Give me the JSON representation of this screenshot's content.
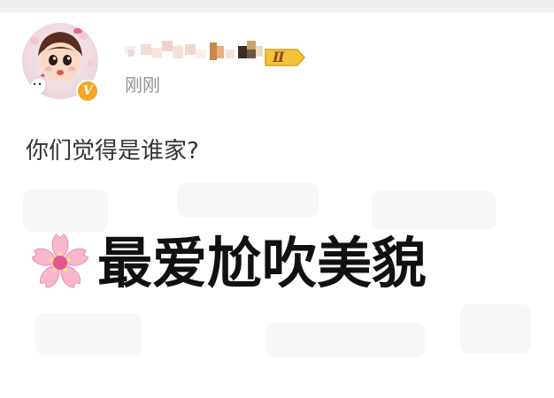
{
  "post": {
    "timestamp": "刚刚",
    "text": "你们觉得是谁家?",
    "image_caption": "最爱尬吹美貌",
    "image_emoji_icon": "cherry-blossom-icon"
  },
  "user": {
    "avatar_icon": "cartoon-girl-avatar",
    "verified_icon": "verified-v-icon",
    "verified_letter": "V",
    "level_badge_icon": "level-badge-icon",
    "level_badge_text": "Ⅱ"
  },
  "colors": {
    "verified": "#f5a623",
    "level_badge": "#f3c33c",
    "timestamp": "#939393",
    "text": "#333333"
  }
}
